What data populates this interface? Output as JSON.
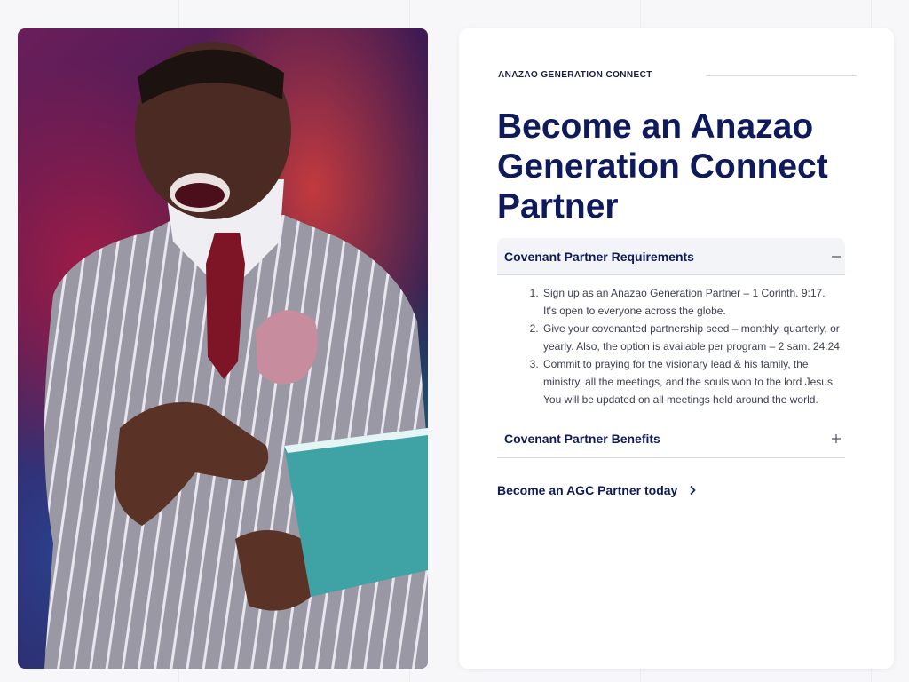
{
  "hero": {
    "alt": ""
  },
  "partner": {
    "eyebrow": "ANAZAO GENERATION CONNECT",
    "title": "Become an Anazao Generation Connect Partner"
  },
  "accordion": {
    "requirements": {
      "label": "Covenant Partner Requirements",
      "state_icon": "minus-icon",
      "items": [
        "Sign up as an Anazao Generation Partner – 1 Corinth. 9:17. It's open to everyone across the globe.",
        "Give your covenanted partnership seed – monthly, quarterly, or yearly. Also, the option is available per program – 2 sam. 24:24",
        "Commit to praying for the visionary lead & his family, the ministry, all the meetings, and the souls won to the lord Jesus. You will be updated on all meetings held around the world."
      ]
    },
    "benefits": {
      "label": "Covenant Partner Benefits",
      "state_icon": "plus-icon"
    }
  },
  "cta": {
    "label": "Become an AGC Partner today",
    "icon": "chevron-right-icon"
  },
  "colors": {
    "heading": "#0f1a5a",
    "body_text": "#3d4050",
    "card_bg": "#ffffff",
    "page_bg": "#f7f7f9",
    "open_header_bg": "#f3f4f8"
  }
}
